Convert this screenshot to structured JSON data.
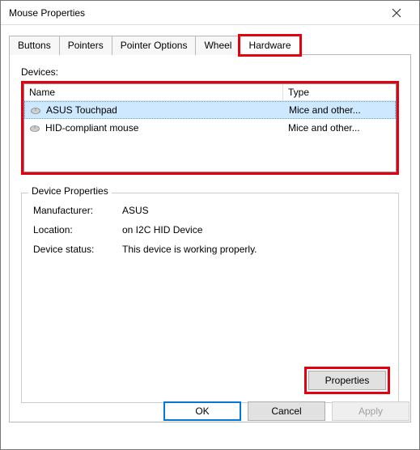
{
  "window": {
    "title": "Mouse Properties"
  },
  "tabs": {
    "buttons": "Buttons",
    "pointers": "Pointers",
    "pointer_options": "Pointer Options",
    "wheel": "Wheel",
    "hardware": "Hardware"
  },
  "devices": {
    "label": "Devices:",
    "columns": {
      "name": "Name",
      "type": "Type"
    },
    "rows": [
      {
        "name": "ASUS Touchpad",
        "type": "Mice and other..."
      },
      {
        "name": "HID-compliant mouse",
        "type": "Mice and other..."
      }
    ]
  },
  "properties": {
    "legend": "Device Properties",
    "manufacturer_label": "Manufacturer:",
    "manufacturer": "ASUS",
    "location_label": "Location:",
    "location": "on I2C HID Device",
    "status_label": "Device status:",
    "status": "This device is working properly.",
    "properties_button": "Properties"
  },
  "footer": {
    "ok": "OK",
    "cancel": "Cancel",
    "apply": "Apply"
  },
  "colors": {
    "highlight": "#e3000f",
    "selection": "#cde8ff",
    "accent": "#0078d7"
  }
}
